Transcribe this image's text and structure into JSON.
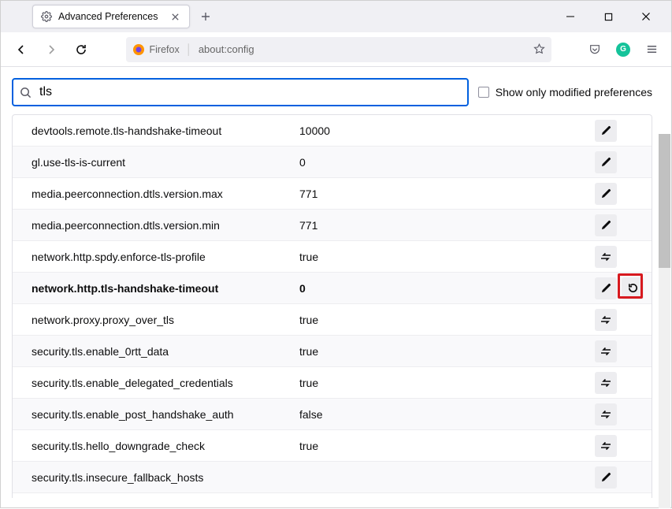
{
  "window": {
    "tab_title": "Advanced Preferences"
  },
  "urlbar": {
    "identity_label": "Firefox",
    "url": "about:config"
  },
  "search": {
    "value": "tls",
    "show_modified_label": "Show only modified preferences"
  },
  "prefs": [
    {
      "name": "devtools.remote.tls-handshake-timeout",
      "value": "10000",
      "action": "edit",
      "modified": false,
      "resettable": false
    },
    {
      "name": "gl.use-tls-is-current",
      "value": "0",
      "action": "edit",
      "modified": false,
      "resettable": false
    },
    {
      "name": "media.peerconnection.dtls.version.max",
      "value": "771",
      "action": "edit",
      "modified": false,
      "resettable": false
    },
    {
      "name": "media.peerconnection.dtls.version.min",
      "value": "771",
      "action": "edit",
      "modified": false,
      "resettable": false
    },
    {
      "name": "network.http.spdy.enforce-tls-profile",
      "value": "true",
      "action": "toggle",
      "modified": false,
      "resettable": false
    },
    {
      "name": "network.http.tls-handshake-timeout",
      "value": "0",
      "action": "edit",
      "modified": true,
      "resettable": true
    },
    {
      "name": "network.proxy.proxy_over_tls",
      "value": "true",
      "action": "toggle",
      "modified": false,
      "resettable": false
    },
    {
      "name": "security.tls.enable_0rtt_data",
      "value": "true",
      "action": "toggle",
      "modified": false,
      "resettable": false
    },
    {
      "name": "security.tls.enable_delegated_credentials",
      "value": "true",
      "action": "toggle",
      "modified": false,
      "resettable": false
    },
    {
      "name": "security.tls.enable_post_handshake_auth",
      "value": "false",
      "action": "toggle",
      "modified": false,
      "resettable": false
    },
    {
      "name": "security.tls.hello_downgrade_check",
      "value": "true",
      "action": "toggle",
      "modified": false,
      "resettable": false
    },
    {
      "name": "security.tls.insecure_fallback_hosts",
      "value": "",
      "action": "edit",
      "modified": false,
      "resettable": false
    }
  ]
}
